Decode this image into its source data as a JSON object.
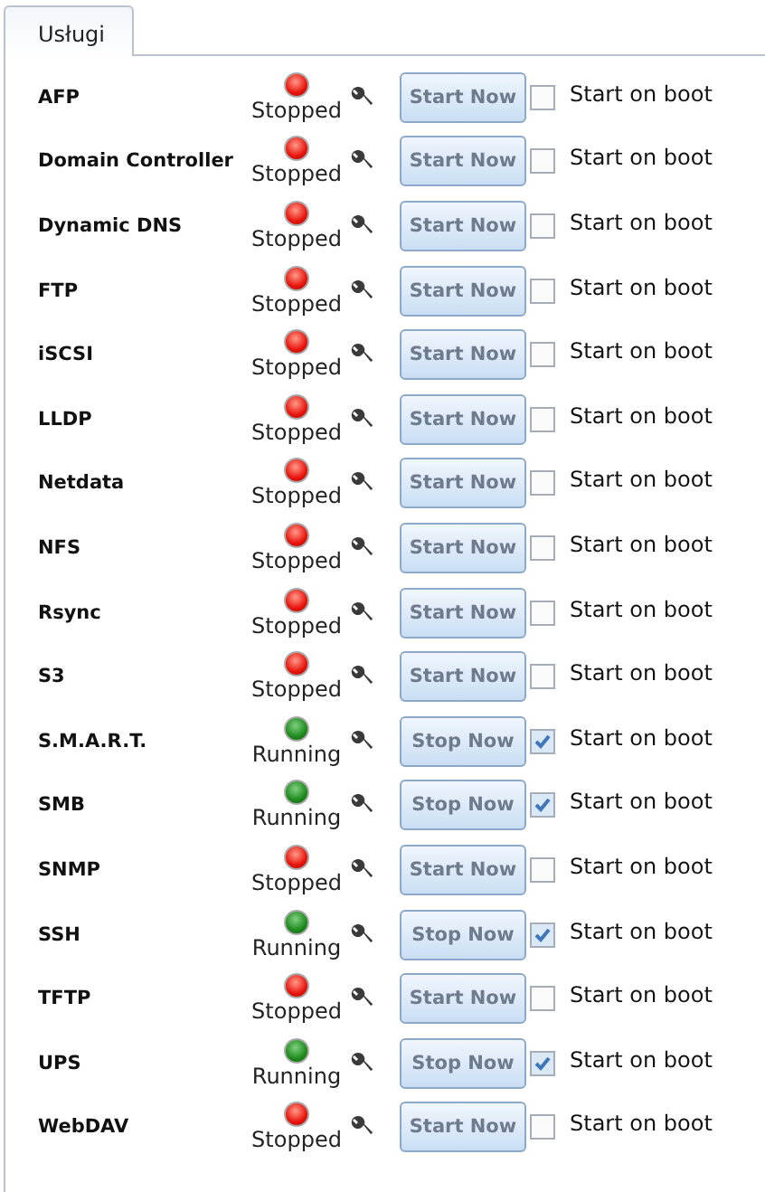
{
  "tabs": [
    {
      "label": "Usługi",
      "selected": true
    }
  ],
  "services": [
    {
      "name": "AFP",
      "running": false,
      "status": "Stopped",
      "action": "Start Now",
      "boot_label": "Start on boot",
      "checked": false
    },
    {
      "name": "Domain Controller",
      "running": false,
      "status": "Stopped",
      "action": "Start Now",
      "boot_label": "Start on boot",
      "checked": false
    },
    {
      "name": "Dynamic DNS",
      "running": false,
      "status": "Stopped",
      "action": "Start Now",
      "boot_label": "Start on boot",
      "checked": false
    },
    {
      "name": "FTP",
      "running": false,
      "status": "Stopped",
      "action": "Start Now",
      "boot_label": "Start on boot",
      "checked": false
    },
    {
      "name": "iSCSI",
      "running": false,
      "status": "Stopped",
      "action": "Start Now",
      "boot_label": "Start on boot",
      "checked": false
    },
    {
      "name": "LLDP",
      "running": false,
      "status": "Stopped",
      "action": "Start Now",
      "boot_label": "Start on boot",
      "checked": false
    },
    {
      "name": "Netdata",
      "running": false,
      "status": "Stopped",
      "action": "Start Now",
      "boot_label": "Start on boot",
      "checked": false
    },
    {
      "name": "NFS",
      "running": false,
      "status": "Stopped",
      "action": "Start Now",
      "boot_label": "Start on boot",
      "checked": false
    },
    {
      "name": "Rsync",
      "running": false,
      "status": "Stopped",
      "action": "Start Now",
      "boot_label": "Start on boot",
      "checked": false
    },
    {
      "name": "S3",
      "running": false,
      "status": "Stopped",
      "action": "Start Now",
      "boot_label": "Start on boot",
      "checked": false
    },
    {
      "name": "S.M.A.R.T.",
      "running": true,
      "status": "Running",
      "action": "Stop Now",
      "boot_label": "Start on boot",
      "checked": true
    },
    {
      "name": "SMB",
      "running": true,
      "status": "Running",
      "action": "Stop Now",
      "boot_label": "Start on boot",
      "checked": true
    },
    {
      "name": "SNMP",
      "running": false,
      "status": "Stopped",
      "action": "Start Now",
      "boot_label": "Start on boot",
      "checked": false
    },
    {
      "name": "SSH",
      "running": true,
      "status": "Running",
      "action": "Stop Now",
      "boot_label": "Start on boot",
      "checked": true
    },
    {
      "name": "TFTP",
      "running": false,
      "status": "Stopped",
      "action": "Start Now",
      "boot_label": "Start on boot",
      "checked": false
    },
    {
      "name": "UPS",
      "running": true,
      "status": "Running",
      "action": "Stop Now",
      "boot_label": "Start on boot",
      "checked": true
    },
    {
      "name": "WebDAV",
      "running": false,
      "status": "Stopped",
      "action": "Start Now",
      "boot_label": "Start on boot",
      "checked": false
    }
  ]
}
